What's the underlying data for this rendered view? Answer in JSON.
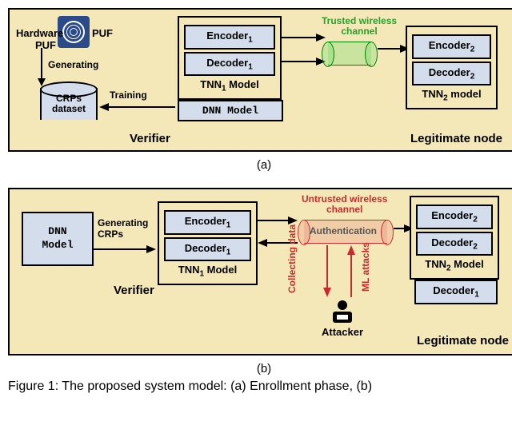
{
  "panel_a": {
    "puf_label": "Hardware PUF",
    "crps_label": "CRPs\ndataset",
    "arrow_generating": "Generating",
    "arrow_training": "Training",
    "tnn1": {
      "encoder": "Encoder",
      "encoder_sub": "1",
      "decoder": "Decoder",
      "decoder_sub": "1",
      "label": "TNN",
      "label_sub": "1",
      "label_suffix": " Model"
    },
    "dnn": "DNN Model",
    "verifier": "Verifier",
    "channel_label": "Trusted wireless\nchannel",
    "tnn2": {
      "encoder": "Encoder",
      "encoder_sub": "2",
      "decoder": "Decoder",
      "decoder_sub": "2",
      "label": "TNN",
      "label_sub": "2",
      "label_suffix": " model"
    },
    "legitimate": "Legitimate node"
  },
  "panel_b": {
    "dnn": "DNN\nModel",
    "arrow_generating": "Generating",
    "arrow_crps": "CRPs",
    "tnn1": {
      "encoder": "Encoder",
      "encoder_sub": "1",
      "decoder": "Decoder",
      "decoder_sub": "1",
      "label": "TNN",
      "label_sub": "1",
      "label_suffix": " Model"
    },
    "verifier": "Verifier",
    "channel_label": "Untrusted wireless\nchannel",
    "auth_label": "Authentication",
    "tnn2": {
      "encoder": "Encoder",
      "encoder_sub": "2",
      "decoder": "Decoder",
      "decoder_sub": "2",
      "label": "TNN",
      "label_sub": "2",
      "label_suffix": " Model"
    },
    "extra_decoder": "Decoder",
    "extra_decoder_sub": "1",
    "legitimate": "Legitimate node",
    "attacker": "Attacker",
    "collecting": "Collecting data",
    "ml_attacks": "ML attacks"
  },
  "sub_a": "(a)",
  "sub_b": "(b)",
  "caption": "Figure 1: The proposed system model: (a) Enrollment phase, (b)"
}
